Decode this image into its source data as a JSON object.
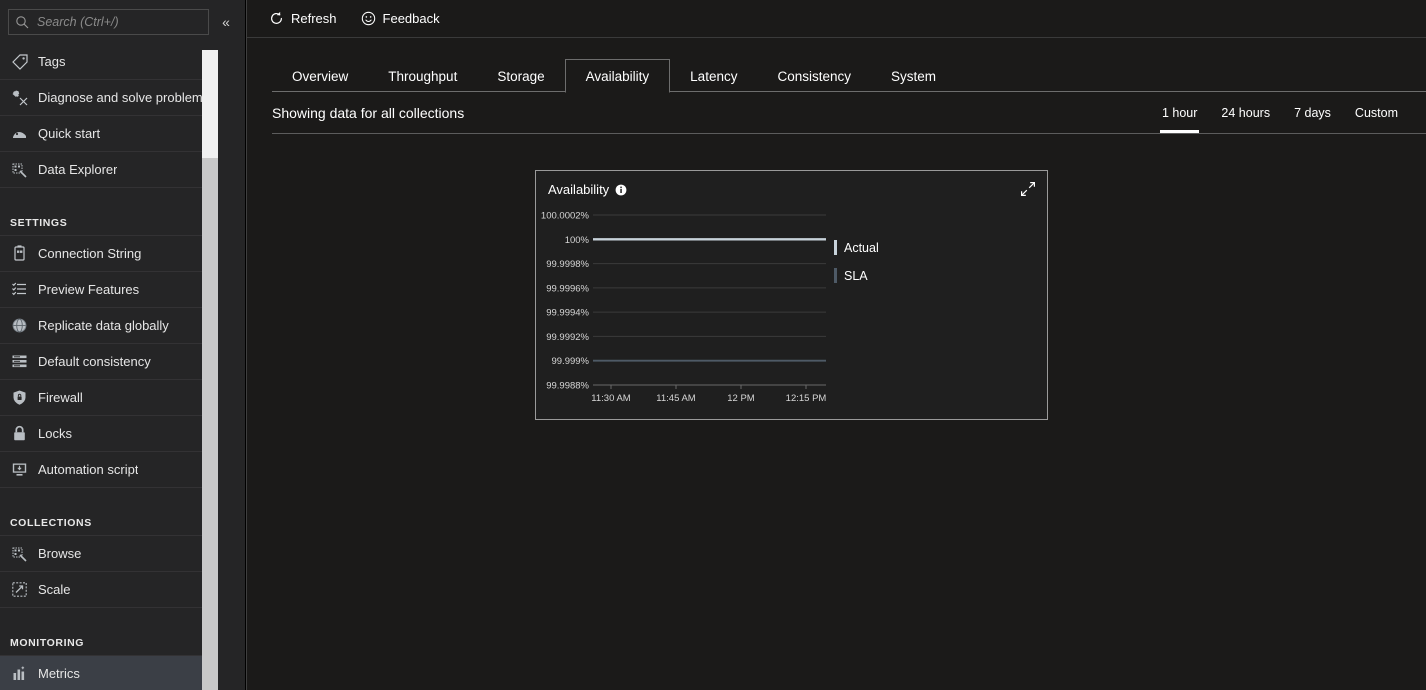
{
  "sidebar": {
    "search": {
      "placeholder": "Search (Ctrl+/)",
      "value": "",
      "icon": "search-icon"
    },
    "collapse_icon": "«",
    "items": [
      {
        "label": "Tags",
        "icon": "tag-icon",
        "type": "item",
        "selected": false
      },
      {
        "label": "Diagnose and solve problems",
        "icon": "wrench-icon",
        "type": "item",
        "selected": false
      },
      {
        "label": "Quick start",
        "icon": "rocket-icon",
        "type": "item",
        "selected": false
      },
      {
        "label": "Data Explorer",
        "icon": "data-explorer-icon",
        "type": "item",
        "selected": false
      },
      {
        "label": "SETTINGS",
        "type": "group"
      },
      {
        "label": "Connection String",
        "icon": "connection-string-icon",
        "type": "item",
        "selected": false
      },
      {
        "label": "Preview Features",
        "icon": "list-icon",
        "type": "item",
        "selected": false
      },
      {
        "label": "Replicate data globally",
        "icon": "globe-icon",
        "type": "item",
        "selected": false
      },
      {
        "label": "Default consistency",
        "icon": "consistency-icon",
        "type": "item",
        "selected": false
      },
      {
        "label": "Firewall",
        "icon": "shield-icon",
        "type": "item",
        "selected": false
      },
      {
        "label": "Locks",
        "icon": "lock-icon",
        "type": "item",
        "selected": false
      },
      {
        "label": "Automation script",
        "icon": "automation-script-icon",
        "type": "item",
        "selected": false
      },
      {
        "label": "COLLECTIONS",
        "type": "group"
      },
      {
        "label": "Browse",
        "icon": "browse-icon",
        "type": "item",
        "selected": false
      },
      {
        "label": "Scale",
        "icon": "scale-icon",
        "type": "item",
        "selected": false
      },
      {
        "label": "MONITORING",
        "type": "group"
      },
      {
        "label": "Metrics",
        "icon": "metrics-icon",
        "type": "item",
        "selected": true
      }
    ]
  },
  "toolbar": {
    "refresh_label": "Refresh",
    "refresh_icon": "refresh-icon",
    "feedback_label": "Feedback",
    "feedback_icon": "smiley-icon"
  },
  "tabs": [
    {
      "label": "Overview",
      "active": false
    },
    {
      "label": "Throughput",
      "active": false
    },
    {
      "label": "Storage",
      "active": false
    },
    {
      "label": "Availability",
      "active": true
    },
    {
      "label": "Latency",
      "active": false
    },
    {
      "label": "Consistency",
      "active": false
    },
    {
      "label": "System",
      "active": false
    }
  ],
  "subbar": {
    "title": "Showing data for all collections",
    "ranges": [
      {
        "label": "1 hour",
        "active": true
      },
      {
        "label": "24 hours",
        "active": false
      },
      {
        "label": "7 days",
        "active": false
      },
      {
        "label": "Custom",
        "active": false
      }
    ]
  },
  "card": {
    "title": "Availability",
    "info_icon": "info-icon",
    "expand_icon": "expand-diagonal-icon"
  },
  "colors": {
    "actual": "#c7d2da",
    "sla": "#4e5a66",
    "grid": "#3b3b3b",
    "axis_text": "#d6d6d6",
    "card_border": "#9a9a9a",
    "accent_underline": "#ffffff"
  },
  "chart_data": {
    "type": "line",
    "title": "Availability",
    "xlabel": "",
    "ylabel": "",
    "grid": true,
    "legend_position": "right",
    "x_ticks": [
      "11:30 AM",
      "11:45 AM",
      "12 PM",
      "12:15 PM"
    ],
    "y_ticks": [
      "100.0002%",
      "100%",
      "99.9998%",
      "99.9996%",
      "99.9994%",
      "99.9992%",
      "99.999%",
      "99.9988%"
    ],
    "ylim": [
      99.9988,
      100.0002
    ],
    "series": [
      {
        "name": "Actual",
        "color": "#c7d2da",
        "x": [
          "11:25 AM",
          "11:30 AM",
          "11:35 AM",
          "11:40 AM",
          "11:45 AM",
          "11:50 AM",
          "11:55 AM",
          "12 PM",
          "12:05 PM",
          "12:10 PM",
          "12:15 PM",
          "12:20 PM"
        ],
        "values": [
          100,
          100,
          100,
          100,
          100,
          100,
          100,
          100,
          100,
          100,
          100,
          100
        ]
      },
      {
        "name": "SLA",
        "color": "#4e5a66",
        "x": [
          "11:25 AM",
          "11:30 AM",
          "11:35 AM",
          "11:40 AM",
          "11:45 AM",
          "11:50 AM",
          "11:55 AM",
          "12 PM",
          "12:05 PM",
          "12:10 PM",
          "12:15 PM",
          "12:20 PM"
        ],
        "values": [
          99.999,
          99.999,
          99.999,
          99.999,
          99.999,
          99.999,
          99.999,
          99.999,
          99.999,
          99.999,
          99.999,
          99.999
        ]
      }
    ],
    "legend": [
      "Actual",
      "SLA"
    ]
  }
}
